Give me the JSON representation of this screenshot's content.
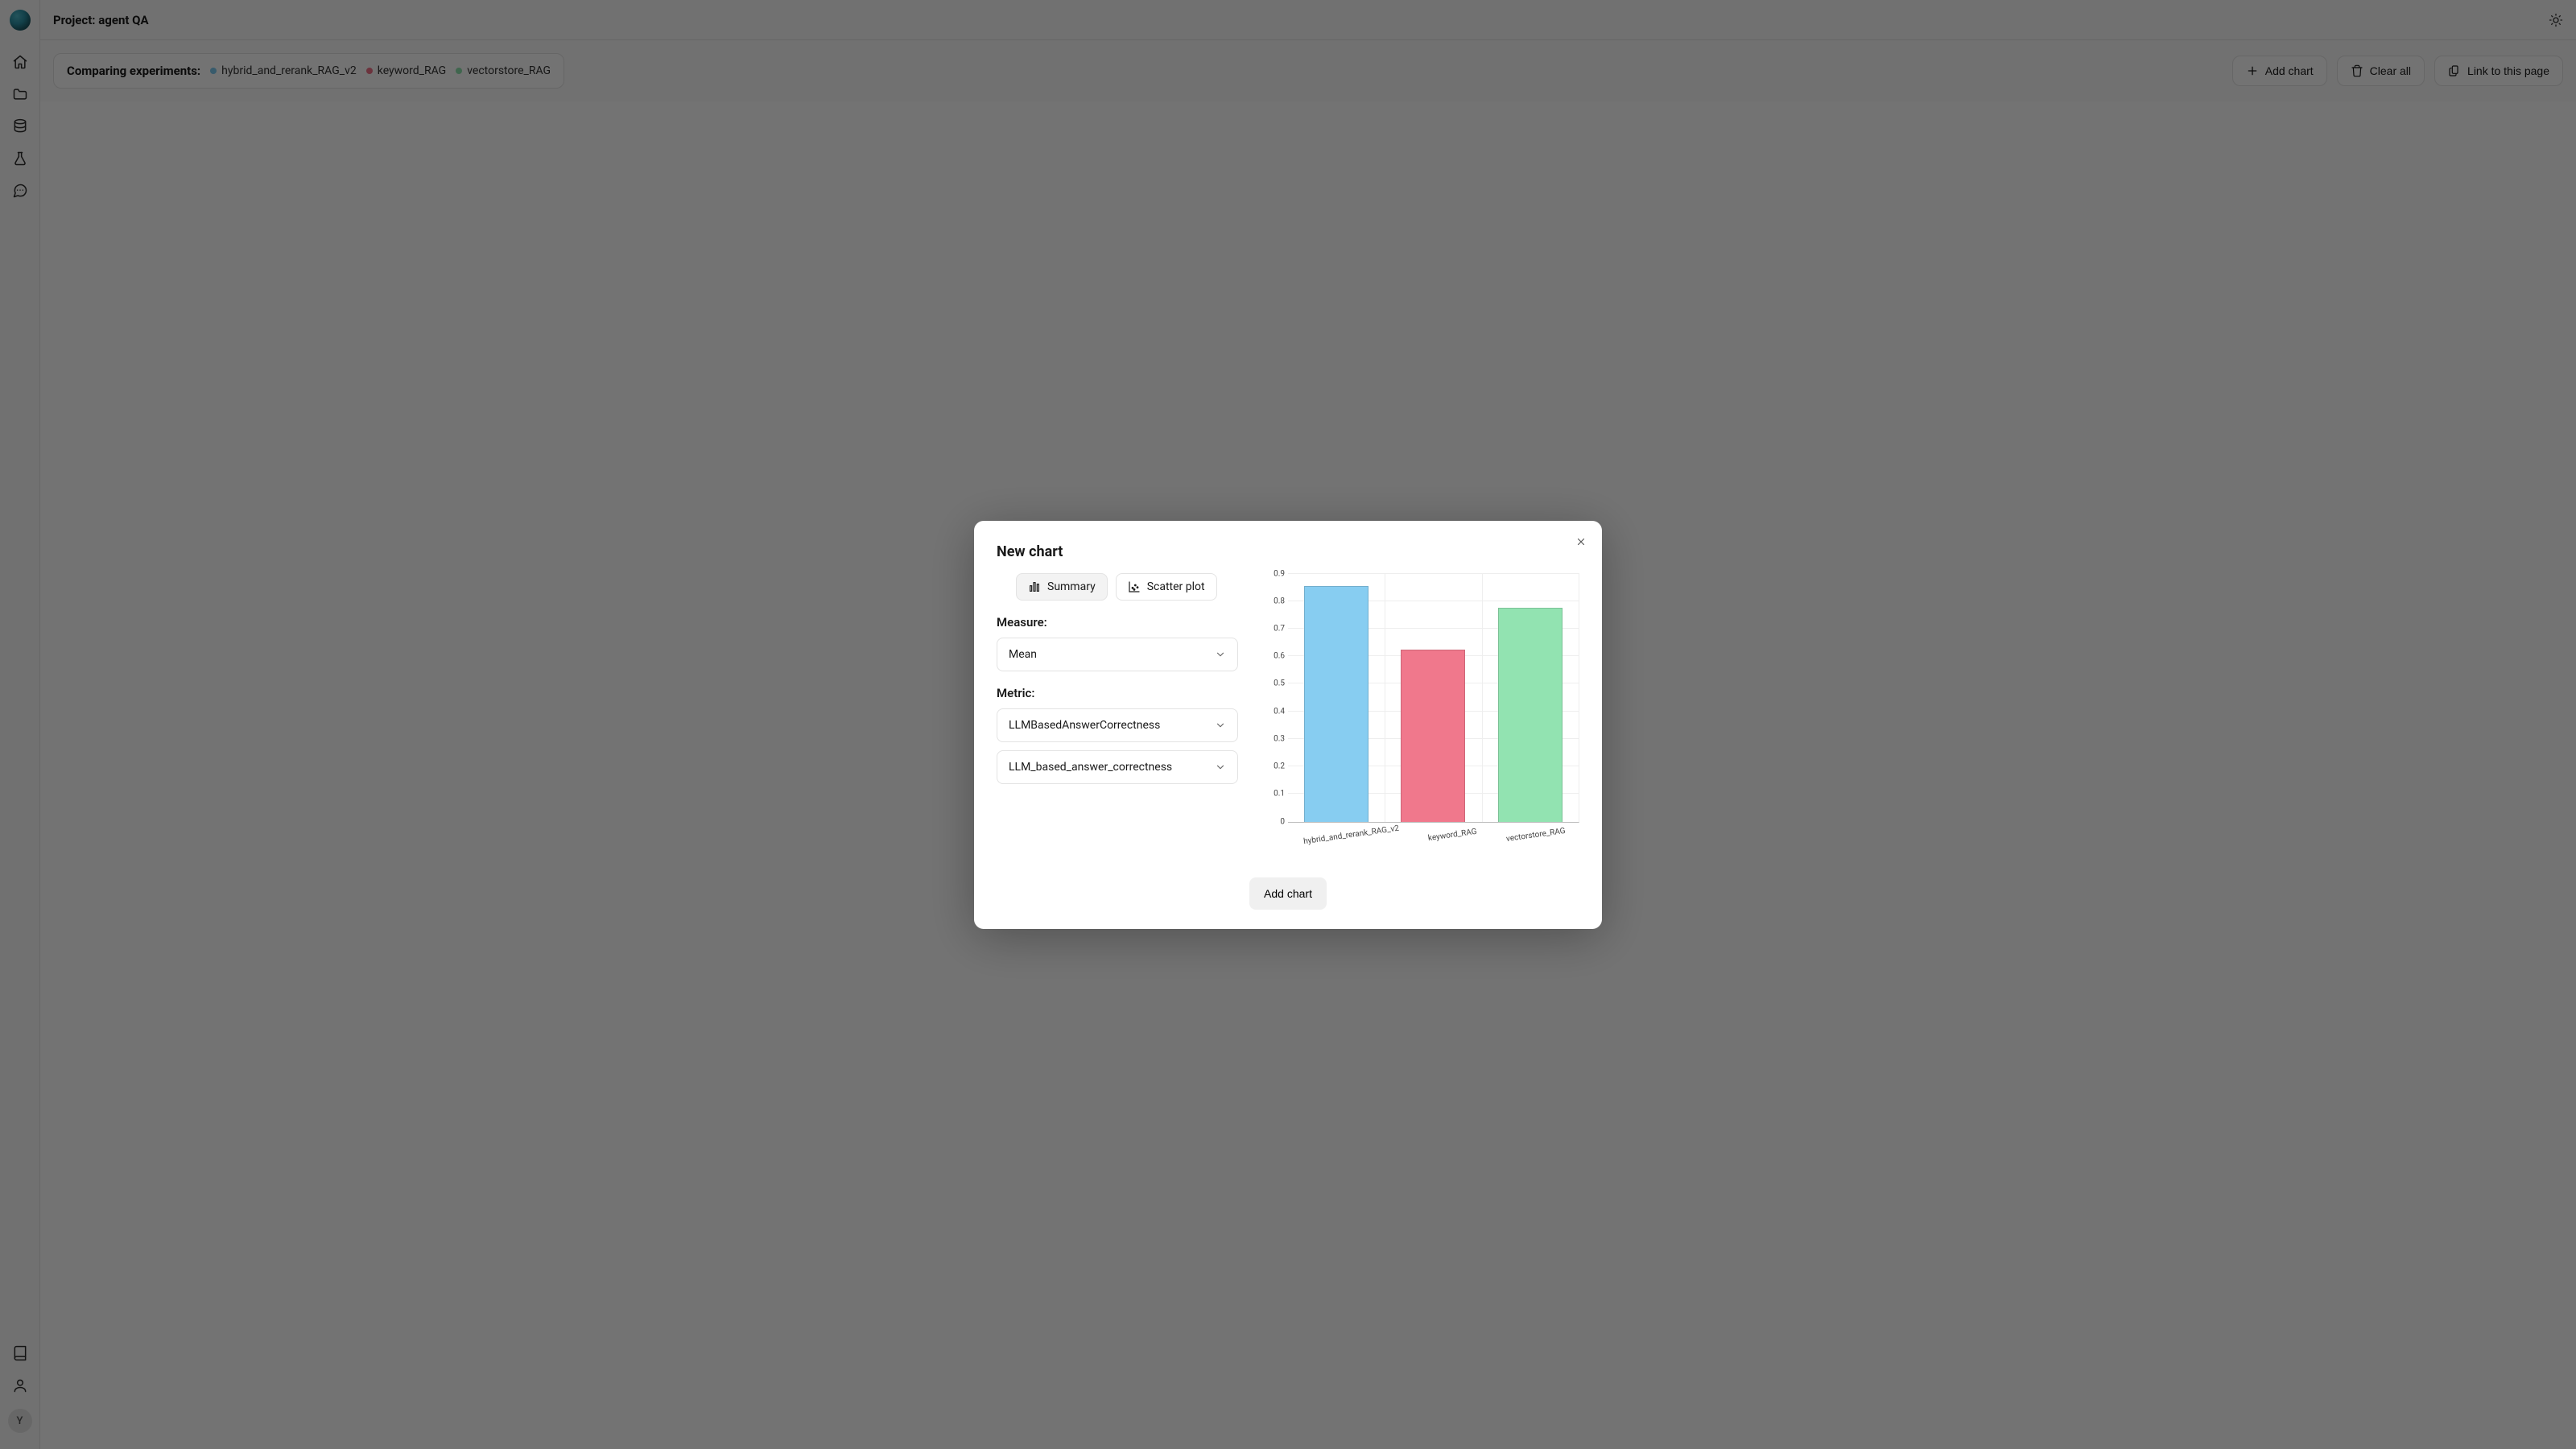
{
  "header": {
    "title": "Project: agent QA"
  },
  "sidebar": {
    "avatar_initial": "Y"
  },
  "compare": {
    "label": "Comparing experiments:",
    "experiments": [
      {
        "name": "hybrid_and_rerank_RAG_v2",
        "color": "#7cc9ef"
      },
      {
        "name": "keyword_RAG",
        "color": "#ef7287"
      },
      {
        "name": "vectorstore_RAG",
        "color": "#8ee2ae"
      }
    ]
  },
  "actions": {
    "add_chart": "Add chart",
    "clear_all": "Clear all",
    "link_page": "Link to this page"
  },
  "modal": {
    "title": "New chart",
    "tabs": {
      "summary": "Summary",
      "scatter": "Scatter plot"
    },
    "measure_label": "Measure:",
    "measure_value": "Mean",
    "metric_label": "Metric:",
    "metric_value_1": "LLMBasedAnswerCorrectness",
    "metric_value_2": "LLM_based_answer_correctness",
    "add_button": "Add chart"
  },
  "chart_data": {
    "type": "bar",
    "categories": [
      "hybrid_and_rerank_RAG_v2",
      "keyword_RAG",
      "vectorstore_RAG"
    ],
    "values": [
      0.85,
      0.62,
      0.77
    ],
    "colors": [
      "#87cdf1",
      "#f0788c",
      "#92e3b1"
    ],
    "ylim": [
      0,
      0.9
    ],
    "yticks": [
      0,
      0.1,
      0.2,
      0.3,
      0.4,
      0.5,
      0.6,
      0.7,
      0.8,
      0.9
    ],
    "title": "",
    "xlabel": "",
    "ylabel": ""
  }
}
